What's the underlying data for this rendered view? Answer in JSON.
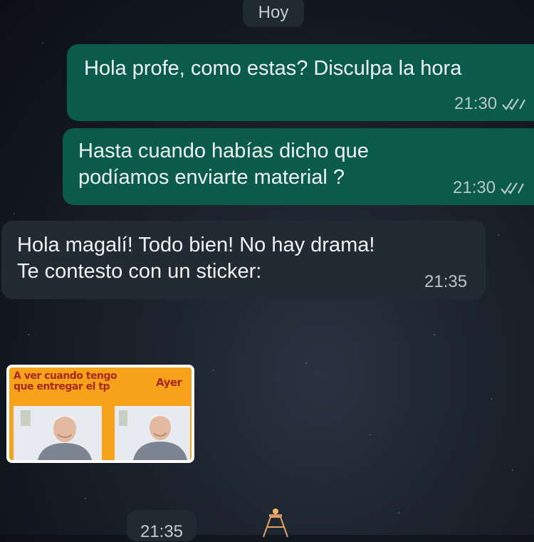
{
  "chat": {
    "date_divider": "Hoy",
    "messages": [
      {
        "direction": "outgoing",
        "text": "Hola profe, como estas? Disculpa la hora",
        "time": "21:30",
        "status": "read"
      },
      {
        "direction": "outgoing",
        "text_lines": [
          "Hasta cuando habías dicho que",
          "podíamos enviarte material ?"
        ],
        "time": "21:30",
        "status": "read"
      },
      {
        "direction": "incoming",
        "text_lines": [
          "Hola magalí! Todo bien! No hay drama!",
          "Te contesto con un sticker:"
        ],
        "time": "21:35"
      }
    ],
    "sticker": {
      "left_caption_lines": [
        "A ver cuando tengo",
        "que entregar el tp"
      ],
      "right_caption": "Ayer",
      "time": "21:35"
    }
  },
  "colors": {
    "outgoing_bubble": "#0b5b4c",
    "incoming_bubble": "#222b33",
    "date_pill": "#1f2a33",
    "sticker_background": "#f6a21a",
    "sticker_text": "#a8281e"
  },
  "icons": [
    "double-check-icon",
    "double-check-icon"
  ]
}
